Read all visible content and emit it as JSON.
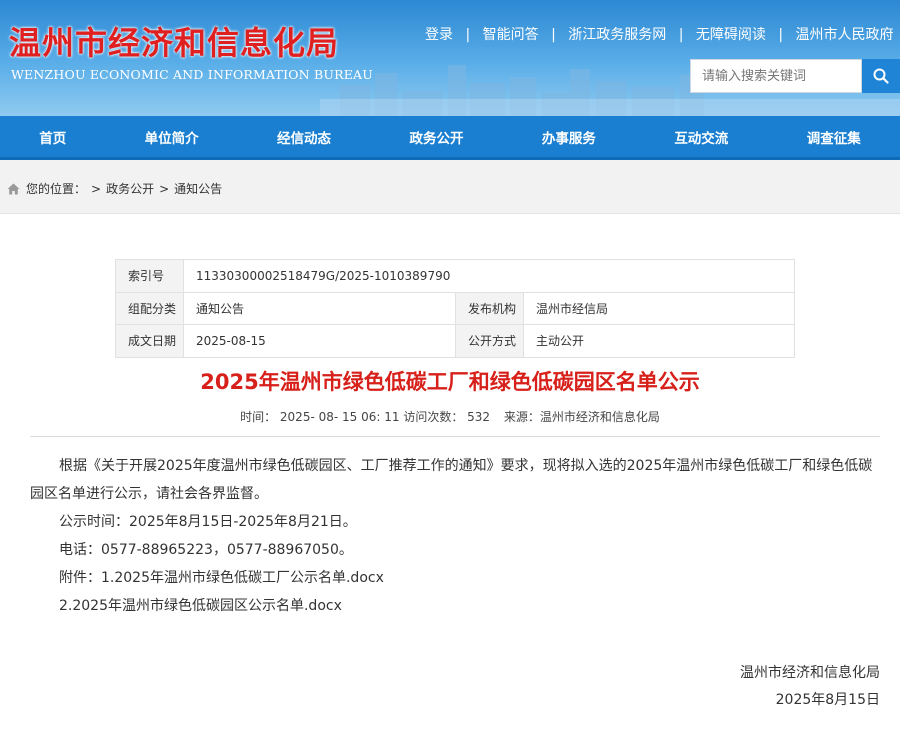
{
  "header": {
    "logo_cn": "温州市经济和信息化局",
    "logo_en": "WENZHOU ECONOMIC AND INFORMATION BUREAU",
    "top_links": [
      "登录",
      "智能问答",
      "浙江政务服务网",
      "无障碍阅读",
      "温州市人民政府"
    ],
    "search_placeholder": "请输入搜索关键词",
    "colors": {
      "header_blue": "#2d88d3",
      "logo_red": "#e02020",
      "search_button": "#1f84d6"
    }
  },
  "nav": {
    "items": [
      "首页",
      "单位简介",
      "经信动态",
      "政务公开",
      "办事服务",
      "互动交流",
      "调查征集"
    ],
    "color": "#1a7fd0"
  },
  "breadcrumb": {
    "label": "您的位置：",
    "items": [
      "政务公开",
      "通知公告"
    ],
    "separator": ">"
  },
  "info": {
    "index_label": "索引号",
    "index_value": "11330300002518479G/2025-1010389790",
    "category_label": "组配分类",
    "category_value": "通知公告",
    "publisher_label": "发布机构",
    "publisher_value": "温州市经信局",
    "date_label": "成文日期",
    "date_value": "2025-08-15",
    "method_label": "公开方式",
    "method_value": "主动公开"
  },
  "article": {
    "title": "2025年温州市绿色低碳工厂和绿色低碳园区名单公示",
    "title_color": "#d7201a",
    "meta_time": "时间： 2025- 08- 15 06: 11",
    "meta_visits": "访问次数：  532",
    "meta_source": "来源：温州市经济和信息化局",
    "para1": "根据《关于开展2025年度温州市绿色低碳园区、工厂推荐工作的通知》要求，现将拟入选的2025年温州市绿色低碳工厂和绿色低碳园区名单进行公示，请社会各界监督。",
    "period": "公示时间：2025年8月15日-2025年8月21日。",
    "phone": "电话：0577-88965223，0577-88967050。",
    "attach_label": "附件：",
    "attach1": "1.2025年温州市绿色低碳工厂公示名单.docx",
    "attach2": "2.2025年温州市绿色低碳园区公示名单.docx",
    "sign_org": "温州市经济和信息化局",
    "sign_date": "2025年8月15日"
  }
}
